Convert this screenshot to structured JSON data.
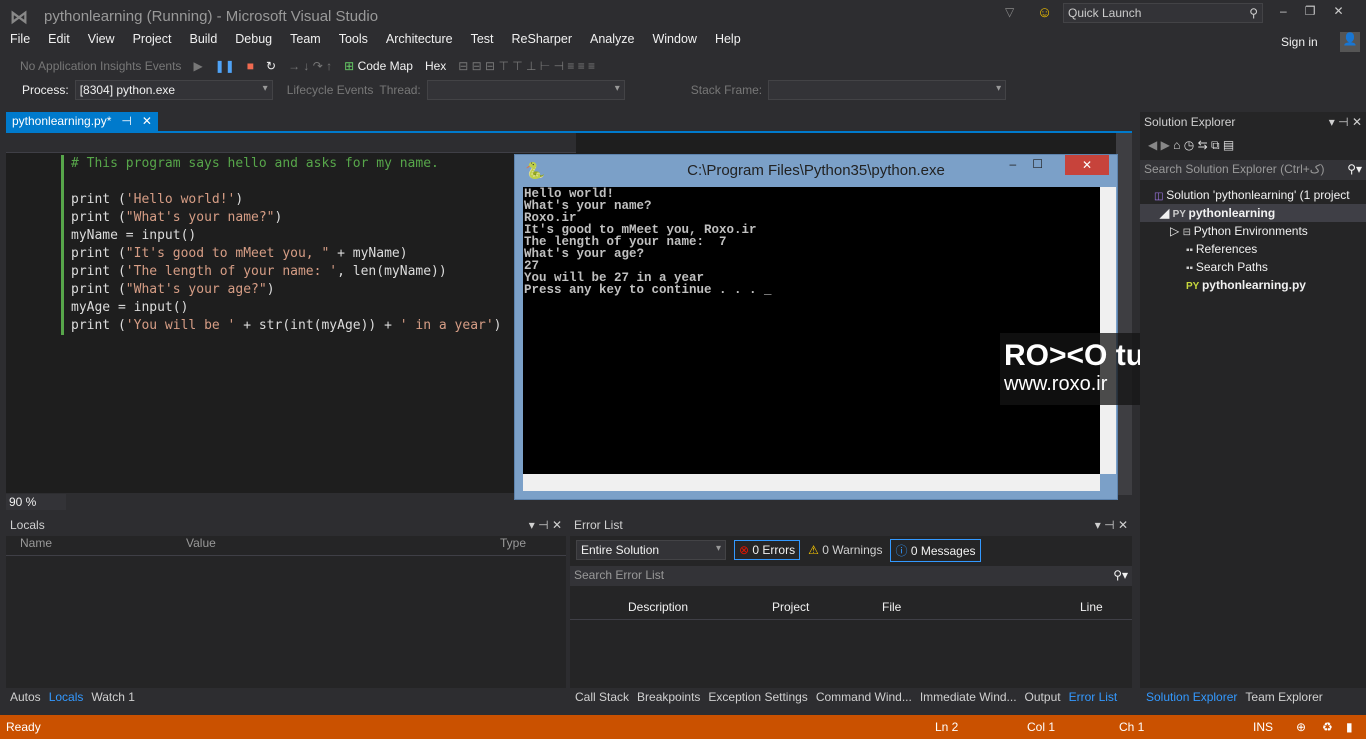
{
  "window": {
    "title": "pythonlearning (Running) - Microsoft Visual Studio",
    "quick_launch": "Quick Launch",
    "sign_in": "Sign in"
  },
  "menu": [
    "File",
    "Edit",
    "View",
    "Project",
    "Build",
    "Debug",
    "Team",
    "Tools",
    "Architecture",
    "Test",
    "ReSharper",
    "Analyze",
    "Window",
    "Help"
  ],
  "toolbar": {
    "insights": "No Application Insights Events",
    "code_map": "Code Map",
    "hex": "Hex"
  },
  "debugbar": {
    "process_label": "Process:",
    "process_value": "[8304] python.exe",
    "lifecycle": "Lifecycle Events",
    "thread_label": "Thread:",
    "stack_label": "Stack Frame:"
  },
  "doc_tab": {
    "label": "pythonlearning.py*"
  },
  "editor": {
    "zoom": "90 %",
    "lines": [
      [
        [
          "# This program says hello and asks for my name.",
          "cmt"
        ]
      ],
      [
        [
          "",
          ""
        ]
      ],
      [
        [
          "print (",
          ""
        ],
        [
          "'Hello world!'",
          "str"
        ],
        [
          ")",
          ""
        ]
      ],
      [
        [
          "print (",
          ""
        ],
        [
          "\"What's your name?\"",
          "str"
        ],
        [
          ")",
          ""
        ]
      ],
      [
        [
          "myName = input()",
          ""
        ]
      ],
      [
        [
          "print (",
          ""
        ],
        [
          "\"It's good to mMeet you, \"",
          "str"
        ],
        [
          " + myName)",
          ""
        ]
      ],
      [
        [
          "print (",
          ""
        ],
        [
          "'The length of your name: '",
          "str"
        ],
        [
          ", len(myName))",
          ""
        ]
      ],
      [
        [
          "print (",
          ""
        ],
        [
          "\"What's your age?\"",
          "str"
        ],
        [
          ")",
          ""
        ]
      ],
      [
        [
          "myAge = input()",
          ""
        ]
      ],
      [
        [
          "print (",
          ""
        ],
        [
          "'You will be '",
          "str"
        ],
        [
          " + str(int(myAge)) + ",
          ""
        ],
        [
          "' in a year'",
          "str"
        ],
        [
          ")",
          ""
        ]
      ]
    ]
  },
  "console": {
    "title": "C:\\Program Files\\Python35\\python.exe",
    "output": "Hello world!\nWhat's your name?\nRoxo.ir\nIt's good to mMeet you, Roxo.ir\nThe length of your name:  7\nWhat's your age?\n27\nYou will be 27 in a year\nPress any key to continue . . . _"
  },
  "watermark": {
    "brand": "RO><O tuts",
    "url": "www.roxo.ir"
  },
  "locals": {
    "title": "Locals",
    "columns": [
      "Name",
      "Value",
      "Type"
    ],
    "tabs": [
      "Autos",
      "Locals",
      "Watch 1"
    ],
    "active_tab": "Locals"
  },
  "error_list": {
    "title": "Error List",
    "scope": "Entire Solution",
    "errors": "0 Errors",
    "warnings": "0 Warnings",
    "messages": "0 Messages",
    "search_placeholder": "Search Error List",
    "columns": [
      "Description",
      "Project",
      "File",
      "Line"
    ],
    "tabs": [
      "Call Stack",
      "Breakpoints",
      "Exception Settings",
      "Command Wind...",
      "Immediate Wind...",
      "Output",
      "Error List"
    ],
    "active_tab": "Error List"
  },
  "solution_explorer": {
    "title": "Solution Explorer",
    "search_placeholder": "Search Solution Explorer (Ctrl+ک)",
    "items": [
      {
        "label": "Solution 'pythonlearning' (1 project",
        "icon": "solution-icon"
      },
      {
        "label": "pythonlearning",
        "icon": "python-project-icon"
      },
      {
        "label": "Python Environments",
        "icon": "environments-icon"
      },
      {
        "label": "References",
        "icon": "references-icon"
      },
      {
        "label": "Search Paths",
        "icon": "search-paths-icon"
      },
      {
        "label": "pythonlearning.py",
        "icon": "python-file-icon"
      }
    ],
    "tabs": [
      "Solution Explorer",
      "Team Explorer"
    ],
    "active_tab": "Solution Explorer"
  },
  "status": {
    "state": "Ready",
    "ln": "Ln 2",
    "col": "Col 1",
    "ch": "Ch 1",
    "mode": "INS"
  },
  "colors": {
    "accent": "#007acc",
    "status_bar": "#ca5100",
    "background": "#2d2d30",
    "editor": "#1e1e1e"
  }
}
